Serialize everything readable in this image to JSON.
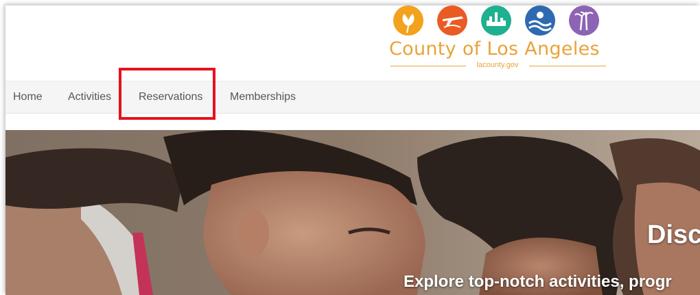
{
  "logo": {
    "title": "County of Los Angeles",
    "subtitle": "lacounty.gov",
    "color": "#e8a33a",
    "icons": [
      {
        "name": "poppy-icon",
        "color": "#f3a21d"
      },
      {
        "name": "airplane-icon",
        "color": "#ea5b24"
      },
      {
        "name": "city-skyline-icon",
        "color": "#1fb08f"
      },
      {
        "name": "ocean-wave-icon",
        "color": "#2e69b1"
      },
      {
        "name": "palm-trees-icon",
        "color": "#8d63b3"
      }
    ]
  },
  "nav": {
    "items": [
      {
        "label": "Home"
      },
      {
        "label": "Activities"
      },
      {
        "label": "Reservations"
      },
      {
        "label": "Memberships"
      }
    ],
    "highlighted": "Reservations",
    "highlight_color": "#e8101e"
  },
  "hero": {
    "heading": "Disc",
    "subheading": "Explore top-notch activities, progr"
  }
}
